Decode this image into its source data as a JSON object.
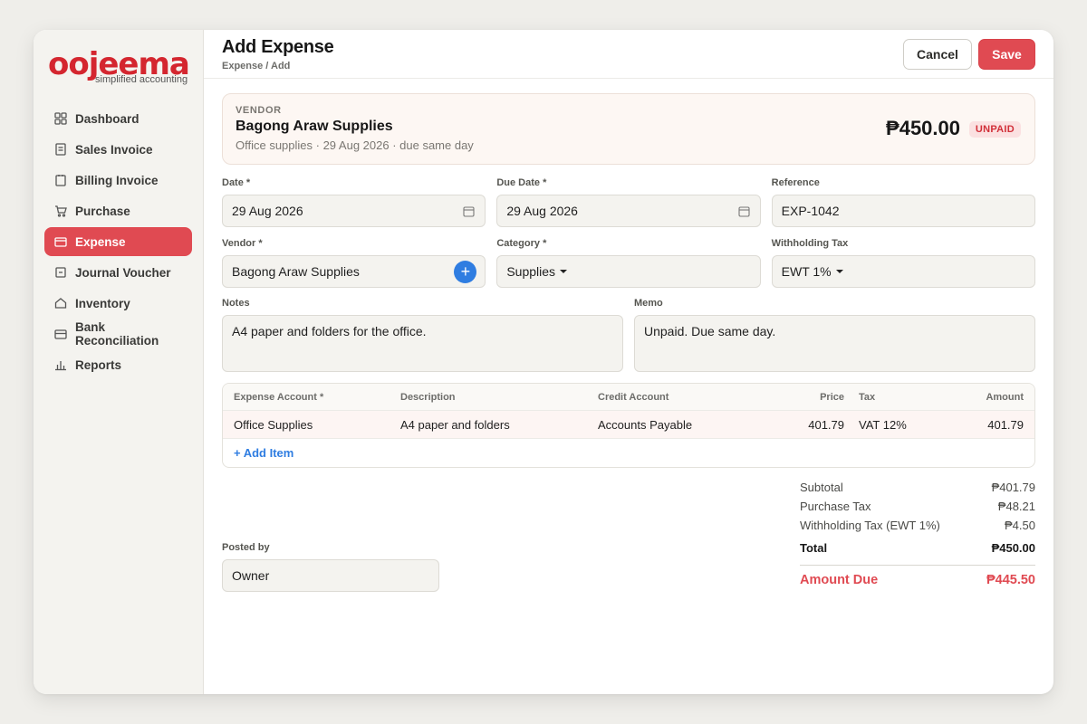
{
  "brand": {
    "name": "oojeema",
    "tagline": "simplified accounting",
    "accent": "#e04a52"
  },
  "sidebar": {
    "items": [
      {
        "label": "Dashboard",
        "icon": "grid-icon"
      },
      {
        "label": "Sales Invoice",
        "icon": "document-icon"
      },
      {
        "label": "Billing Invoice",
        "icon": "clipboard-icon"
      },
      {
        "label": "Purchase",
        "icon": "cart-icon"
      },
      {
        "label": "Expense",
        "icon": "card-icon",
        "active": true
      },
      {
        "label": "Journal Voucher",
        "icon": "journal-icon"
      },
      {
        "label": "Inventory",
        "icon": "house-icon"
      },
      {
        "label": "Bank Reconciliation",
        "icon": "bank-card-icon"
      },
      {
        "label": "Reports",
        "icon": "bar-chart-icon"
      }
    ]
  },
  "header": {
    "title": "Add Expense",
    "breadcrumb": "Expense / Add",
    "cancel_label": "Cancel",
    "save_label": "Save"
  },
  "vendor_card": {
    "label": "VENDOR",
    "name": "Bagong Araw Supplies",
    "subtitle": "Office supplies · 29 Aug 2026 · due same day",
    "amount": "₱450.00",
    "status": "UNPAID"
  },
  "form": {
    "date": {
      "label": "Date *",
      "value": "29 Aug 2026"
    },
    "due_date": {
      "label": "Due Date *",
      "value": "29 Aug 2026"
    },
    "reference": {
      "label": "Reference",
      "value": "EXP-1042"
    },
    "vendor": {
      "label": "Vendor *",
      "value": "Bagong Araw Supplies",
      "add_symbol": "+"
    },
    "category": {
      "label": "Category *",
      "value": "Supplies"
    },
    "withholding_tax": {
      "label": "Withholding Tax",
      "value": "EWT 1%"
    },
    "notes": {
      "label": "Notes",
      "value": "A4 paper and folders for the office."
    },
    "memo": {
      "label": "Memo",
      "value": "Unpaid. Due same day."
    },
    "posted_by": {
      "label": "Posted by",
      "value": "Owner"
    }
  },
  "items_table": {
    "headers": [
      "Expense Account *",
      "Description",
      "Credit Account",
      "Price",
      "Tax",
      "Amount"
    ],
    "rows": [
      [
        "Office Supplies",
        "A4 paper and folders",
        "Accounts Payable",
        "401.79",
        "VAT 12%",
        "401.79"
      ]
    ],
    "add_label": "+ Add Item"
  },
  "totals": {
    "subtotal": {
      "label": "Subtotal",
      "value": "₱401.79"
    },
    "purchase_tax": {
      "label": "Purchase Tax",
      "value": "₱48.21"
    },
    "withholding": {
      "label": "Withholding Tax (EWT 1%)",
      "value": "₱4.50"
    },
    "total": {
      "label": "Total",
      "value": "₱450.00"
    },
    "amount_due": {
      "label": "Amount Due",
      "value": "₱445.50"
    }
  }
}
